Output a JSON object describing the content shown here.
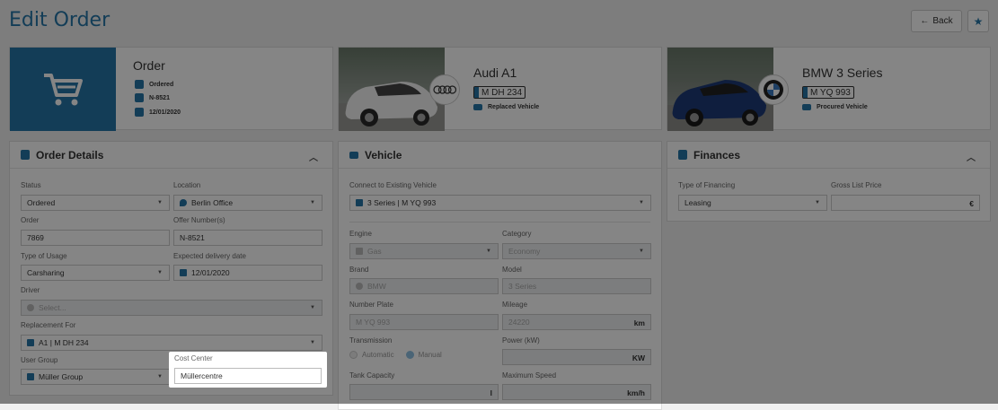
{
  "page": {
    "title": "Edit Order",
    "back_label": "Back"
  },
  "cards": {
    "order": {
      "title": "Order",
      "status": "Ordered",
      "number": "N-8521",
      "date": "12/01/2020",
      "icon": "shopping-cart-icon"
    },
    "replaced": {
      "title": "Audi A1",
      "plate": "M DH 234",
      "note": "Replaced Vehicle",
      "logo": "audi-logo"
    },
    "procured": {
      "title": "BMW 3 Series",
      "plate": "M YQ 993",
      "note": "Procured Vehicle",
      "logo": "bmw-logo"
    }
  },
  "order_details": {
    "title": "Order Details",
    "status_label": "Status",
    "status_value": "Ordered",
    "location_label": "Location",
    "location_value": "Berlin Office",
    "order_label": "Order",
    "order_value": "7869",
    "offer_label": "Offer Number(s)",
    "offer_value": "N-8521",
    "usage_label": "Type of Usage",
    "usage_value": "Carsharing",
    "delivery_label": "Expected delivery date",
    "delivery_value": "12/01/2020",
    "driver_label": "Driver",
    "driver_placeholder": "Select...",
    "replacement_label": "Replacement For",
    "replacement_value": "A1 | M DH 234",
    "usergroup_label": "User Group",
    "usergroup_value": "Müller Group",
    "costcenter_label": "Cost Center",
    "costcenter_value": "Müllercentre"
  },
  "vehicle": {
    "title": "Vehicle",
    "connect_label": "Connect to Existing Vehicle",
    "connect_value": "3 Series | M YQ 993",
    "engine_label": "Engine",
    "engine_value": "Gas",
    "category_label": "Category",
    "category_value": "Economy",
    "brand_label": "Brand",
    "brand_value": "BMW",
    "model_label": "Model",
    "model_value": "3 Series",
    "plate_label": "Number Plate",
    "plate_value": "M YQ 993",
    "mileage_label": "Mileage",
    "mileage_value": "24220",
    "mileage_unit": "km",
    "transmission_label": "Transmission",
    "auto_label": "Automatic",
    "manual_label": "Manual",
    "power_label": "Power (kW)",
    "power_unit": "KW",
    "tank_label": "Tank Capacity",
    "tank_unit": "l",
    "speed_label": "Maximum Speed",
    "speed_unit": "km/h"
  },
  "finances": {
    "title": "Finances",
    "financing_label": "Type of Financing",
    "financing_value": "Leasing",
    "price_label": "Gross List Price",
    "price_unit": "€"
  },
  "colors": {
    "accent": "#2576a8",
    "overlay": "rgba(0,0,0,0.48)"
  }
}
